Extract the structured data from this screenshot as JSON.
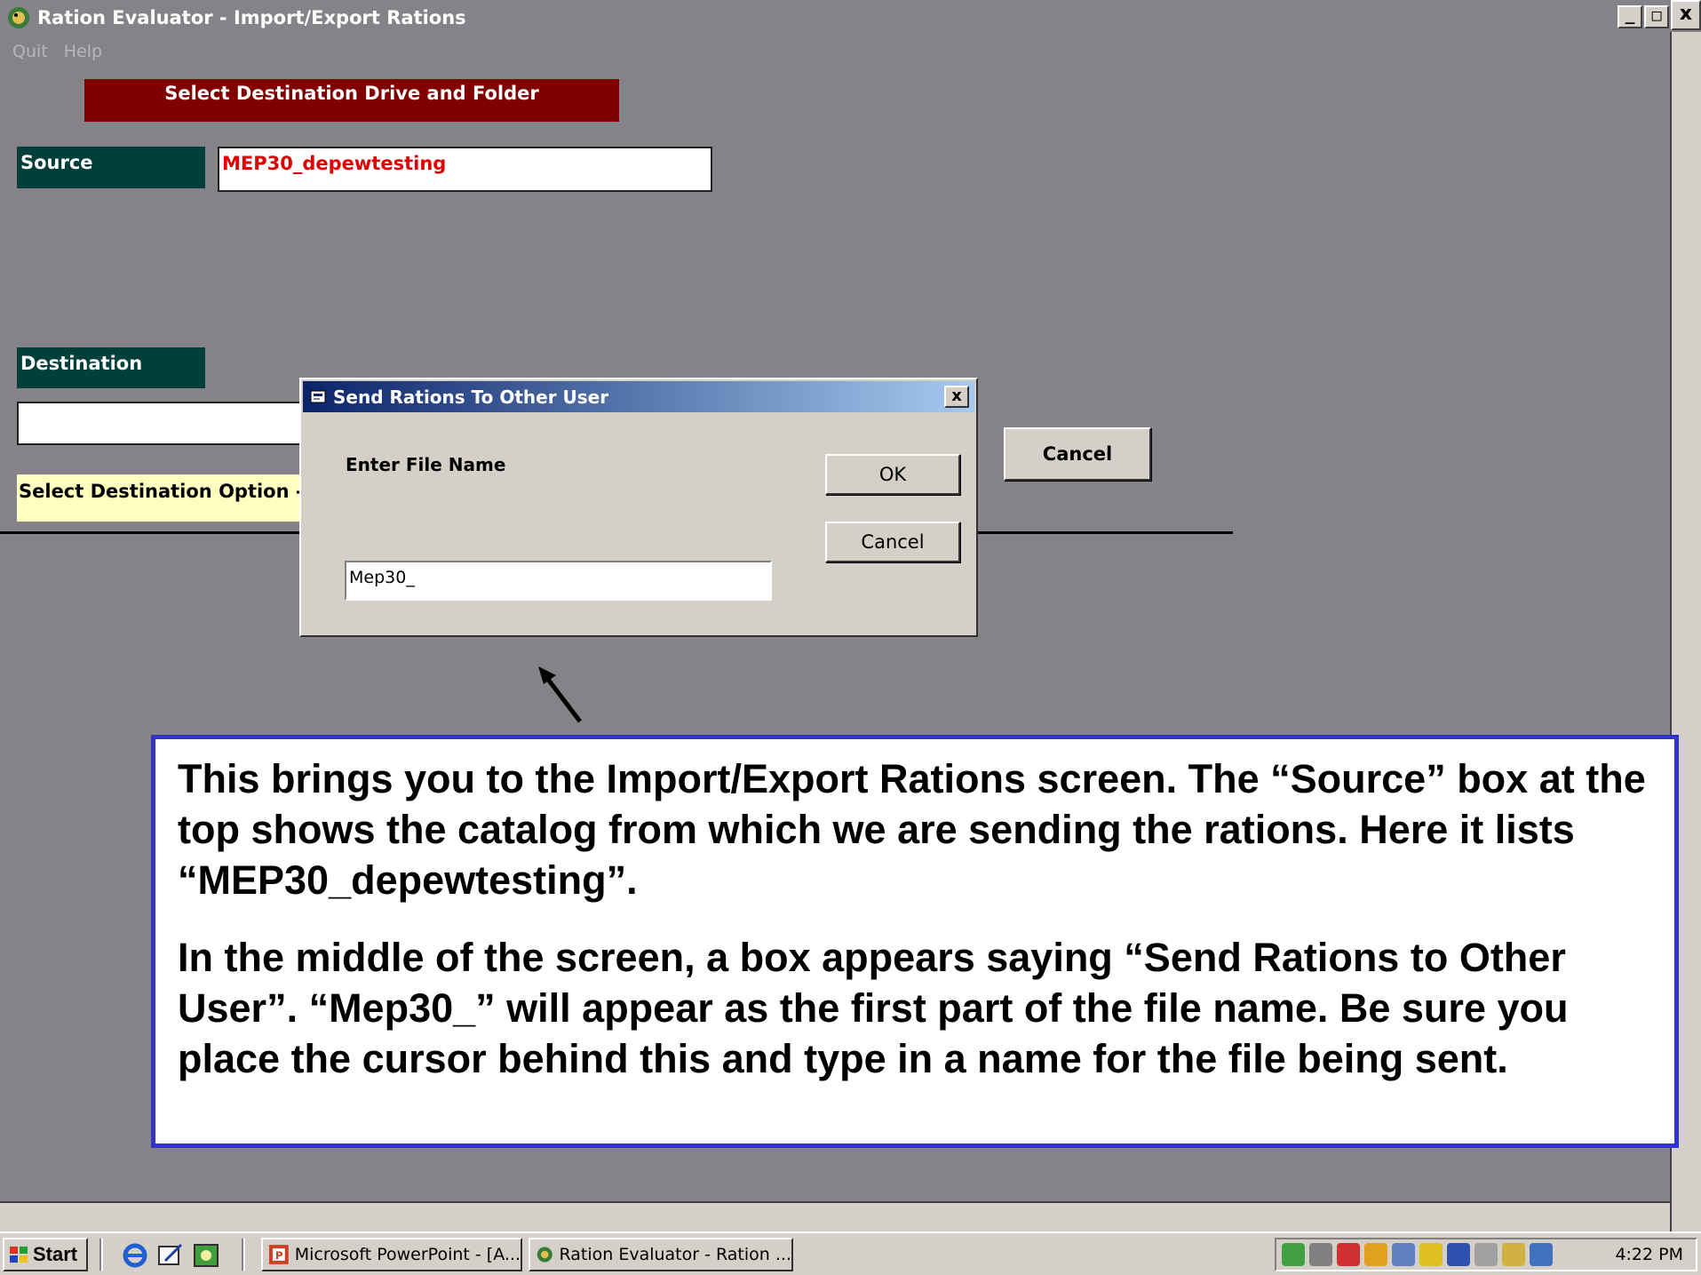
{
  "window": {
    "title": "Ration Evaluator - Import/Export Rations",
    "minimize": "_",
    "maximize": "□",
    "close": "x",
    "outer_close": "x"
  },
  "menu": {
    "items": [
      "Quit",
      "Help"
    ]
  },
  "form": {
    "header_banner": "Select Destination Drive and Folder",
    "source_label": "Source",
    "source_value": "MEP30_depewtesting",
    "destination_label": "Destination",
    "destination_value": "",
    "destination_option": "Select Destination Option - se",
    "cancel_button": "Cancel"
  },
  "dialog": {
    "title": "Send Rations To Other User",
    "close": "x",
    "prompt": "Enter File Name",
    "ok_button": "OK",
    "cancel_button": "Cancel",
    "file_name_value": "Mep30_"
  },
  "annotation": {
    "paragraph_1": "This brings you to the Import/Export Rations screen. The “Source” box at the top shows the catalog from which we are sending the rations. Here it lists “MEP30_depewtesting”.",
    "paragraph_2": "In the middle of the screen, a box appears saying “Send Rations to Other User”. “Mep30_” will appear as the first part of the file name. Be sure you place the cursor behind this and type in a name for the file being sent."
  },
  "taskbar": {
    "start_label": "Start",
    "tasks": [
      {
        "label": "Microsoft PowerPoint - [A...",
        "icon": "powerpoint-icon"
      },
      {
        "label": "Ration Evaluator - Ration ...",
        "icon": "ration-evaluator-icon"
      }
    ],
    "clock": "4:22 PM"
  },
  "colors": {
    "background": "#858387",
    "banner": "#800000",
    "label_teal": "#003f3a",
    "source_text": "#e00000",
    "option_bg": "#ffffc0",
    "callout_border": "#3333cc",
    "dialog_title": "#0a246a"
  }
}
